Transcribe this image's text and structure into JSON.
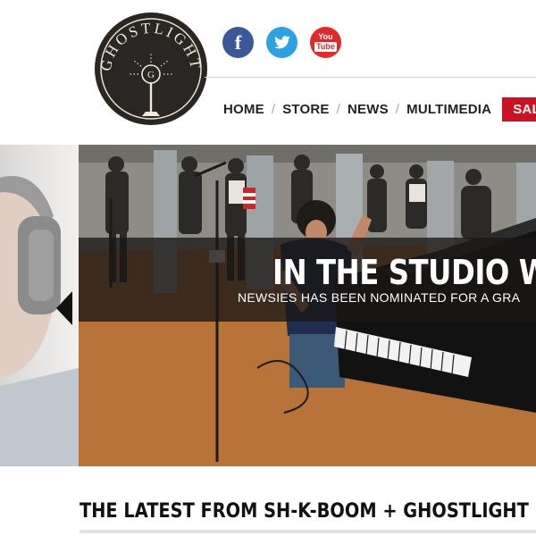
{
  "logo": {
    "text": "GHOSTLIGHT",
    "mark": "G"
  },
  "social": [
    {
      "name": "facebook-icon",
      "glyph": "f"
    },
    {
      "name": "twitter-icon",
      "glyph": "twitter-bird"
    },
    {
      "name": "youtube-icon",
      "line1": "You",
      "line2": "Tube"
    }
  ],
  "nav": {
    "items": [
      "HOME",
      "STORE",
      "NEWS",
      "MULTIMEDIA"
    ],
    "separator": "/",
    "sale": "SALE"
  },
  "hero": {
    "title": "IN THE STUDIO WI",
    "subtitle": "NEWSIES HAS BEEN NOMINATED FOR A GRA"
  },
  "latest": {
    "heading": "THE LATEST FROM SH-K-BOOM + GHOSTLIGHT"
  },
  "colors": {
    "sale": "#cc1122",
    "facebook": "#3b5998",
    "twitter": "#2aa3e0",
    "youtube": "#e02a2a"
  }
}
